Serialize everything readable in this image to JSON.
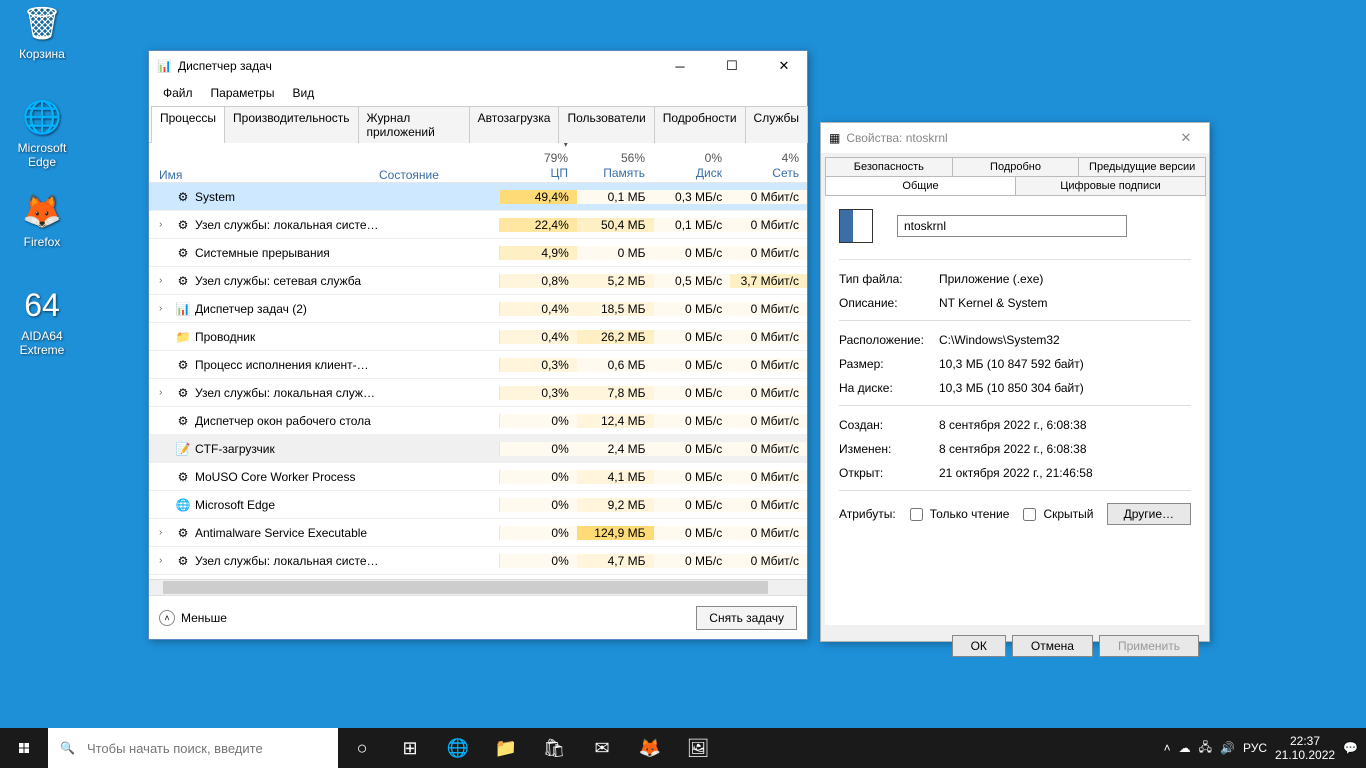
{
  "desktop": {
    "icons": [
      {
        "label": "Корзина",
        "glyph": "🗑"
      },
      {
        "label": "Microsoft Edge",
        "glyph": "🌐"
      },
      {
        "label": "Firefox",
        "glyph": "🦊"
      },
      {
        "label": "AIDA64 Extreme",
        "glyph": "64"
      }
    ]
  },
  "taskmgr": {
    "title": "Диспетчер задач",
    "menu": [
      "Файл",
      "Параметры",
      "Вид"
    ],
    "tabs": [
      "Процессы",
      "Производительность",
      "Журнал приложений",
      "Автозагрузка",
      "Пользователи",
      "Подробности",
      "Службы"
    ],
    "active_tab": 0,
    "columns": {
      "name": "Имя",
      "state": "Состояние",
      "cpu": {
        "pct": "79%",
        "label": "ЦП"
      },
      "mem": {
        "pct": "56%",
        "label": "Память"
      },
      "disk": {
        "pct": "0%",
        "label": "Диск"
      },
      "net": {
        "pct": "4%",
        "label": "Сеть"
      }
    },
    "rows": [
      {
        "chev": "",
        "icon": "⚙",
        "name": "System",
        "cpu": "49,4%",
        "mem": "0,1 МБ",
        "disk": "0,3 МБ/c",
        "net": "0 Мбит/с",
        "h_cpu": 4,
        "h_mem": 0,
        "h_disk": 0,
        "h_net": 0,
        "sel": true
      },
      {
        "chev": "›",
        "icon": "⚙",
        "name": "Узел службы: локальная систе…",
        "cpu": "22,4%",
        "mem": "50,4 МБ",
        "disk": "0,1 МБ/c",
        "net": "0 Мбит/с",
        "h_cpu": 3,
        "h_mem": 2,
        "h_disk": 0,
        "h_net": 0
      },
      {
        "chev": "",
        "icon": "⚙",
        "name": "Системные прерывания",
        "cpu": "4,9%",
        "mem": "0 МБ",
        "disk": "0 МБ/c",
        "net": "0 Мбит/с",
        "h_cpu": 2,
        "h_mem": 0,
        "h_disk": 0,
        "h_net": 0
      },
      {
        "chev": "›",
        "icon": "⚙",
        "name": "Узел службы: сетевая служба",
        "cpu": "0,8%",
        "mem": "5,2 МБ",
        "disk": "0,5 МБ/c",
        "net": "3,7 Мбит/с",
        "h_cpu": 1,
        "h_mem": 1,
        "h_disk": 0,
        "h_net": 2
      },
      {
        "chev": "›",
        "icon": "📊",
        "name": "Диспетчер задач (2)",
        "cpu": "0,4%",
        "mem": "18,5 МБ",
        "disk": "0 МБ/c",
        "net": "0 Мбит/с",
        "h_cpu": 1,
        "h_mem": 1,
        "h_disk": 0,
        "h_net": 0
      },
      {
        "chev": "",
        "icon": "📁",
        "name": "Проводник",
        "cpu": "0,4%",
        "mem": "26,2 МБ",
        "disk": "0 МБ/c",
        "net": "0 Мбит/с",
        "h_cpu": 1,
        "h_mem": 2,
        "h_disk": 0,
        "h_net": 0
      },
      {
        "chev": "",
        "icon": "⚙",
        "name": "Процесс исполнения клиент-…",
        "cpu": "0,3%",
        "mem": "0,6 МБ",
        "disk": "0 МБ/c",
        "net": "0 Мбит/с",
        "h_cpu": 1,
        "h_mem": 0,
        "h_disk": 0,
        "h_net": 0
      },
      {
        "chev": "›",
        "icon": "⚙",
        "name": "Узел службы: локальная служ…",
        "cpu": "0,3%",
        "mem": "7,8 МБ",
        "disk": "0 МБ/c",
        "net": "0 Мбит/с",
        "h_cpu": 1,
        "h_mem": 1,
        "h_disk": 0,
        "h_net": 0
      },
      {
        "chev": "",
        "icon": "⚙",
        "name": "Диспетчер окон рабочего стола",
        "cpu": "0%",
        "mem": "12,4 МБ",
        "disk": "0 МБ/c",
        "net": "0 Мбит/с",
        "h_cpu": 0,
        "h_mem": 1,
        "h_disk": 0,
        "h_net": 0
      },
      {
        "chev": "",
        "icon": "📝",
        "name": "CTF-загрузчик",
        "cpu": "0%",
        "mem": "2,4 МБ",
        "disk": "0 МБ/c",
        "net": "0 Мбит/с",
        "h_cpu": 0,
        "h_mem": 0,
        "h_disk": 0,
        "h_net": 0,
        "hover": true
      },
      {
        "chev": "",
        "icon": "⚙",
        "name": "MoUSO Core Worker Process",
        "cpu": "0%",
        "mem": "4,1 МБ",
        "disk": "0 МБ/c",
        "net": "0 Мбит/с",
        "h_cpu": 0,
        "h_mem": 1,
        "h_disk": 0,
        "h_net": 0
      },
      {
        "chev": "",
        "icon": "🌐",
        "name": "Microsoft Edge",
        "cpu": "0%",
        "mem": "9,2 МБ",
        "disk": "0 МБ/c",
        "net": "0 Мбит/с",
        "h_cpu": 0,
        "h_mem": 1,
        "h_disk": 0,
        "h_net": 0
      },
      {
        "chev": "›",
        "icon": "⚙",
        "name": "Antimalware Service Executable",
        "cpu": "0%",
        "mem": "124,9 МБ",
        "disk": "0 МБ/c",
        "net": "0 Мбит/с",
        "h_cpu": 0,
        "h_mem": 4,
        "h_disk": 0,
        "h_net": 0
      },
      {
        "chev": "›",
        "icon": "⚙",
        "name": "Узел службы: локальная систе…",
        "cpu": "0%",
        "mem": "4,7 МБ",
        "disk": "0 МБ/c",
        "net": "0 Мбит/с",
        "h_cpu": 0,
        "h_mem": 1,
        "h_disk": 0,
        "h_net": 0
      }
    ],
    "less": "Меньше",
    "end_task": "Снять задачу"
  },
  "props": {
    "title": "Свойства: ntoskrnl",
    "tabs_row1": [
      "Безопасность",
      "Подробно",
      "Предыдущие версии"
    ],
    "tabs_row2": [
      "Общие",
      "Цифровые подписи"
    ],
    "active_tab": "Общие",
    "filename": "ntoskrnl",
    "filetype_k": "Тип файла:",
    "filetype_v": "Приложение (.exe)",
    "desc_k": "Описание:",
    "desc_v": "NT Kernel & System",
    "loc_k": "Расположение:",
    "loc_v": "C:\\Windows\\System32",
    "size_k": "Размер:",
    "size_v": "10,3 МБ (10 847 592 байт)",
    "sizedisk_k": "На диске:",
    "sizedisk_v": "10,3 МБ (10 850 304 байт)",
    "created_k": "Создан:",
    "created_v": "8 сентября 2022 г., 6:08:38",
    "modified_k": "Изменен:",
    "modified_v": "8 сентября 2022 г., 6:08:38",
    "accessed_k": "Открыт:",
    "accessed_v": "21 октября 2022 г., 21:46:58",
    "attr_label": "Атрибуты:",
    "readonly": "Только чтение",
    "hidden": "Скрытый",
    "other": "Другие…",
    "ok": "ОК",
    "cancel": "Отмена",
    "apply": "Применить"
  },
  "taskbar": {
    "search_placeholder": "Чтобы начать поиск, введите",
    "lang": "РУС",
    "time": "22:37",
    "date": "21.10.2022"
  }
}
